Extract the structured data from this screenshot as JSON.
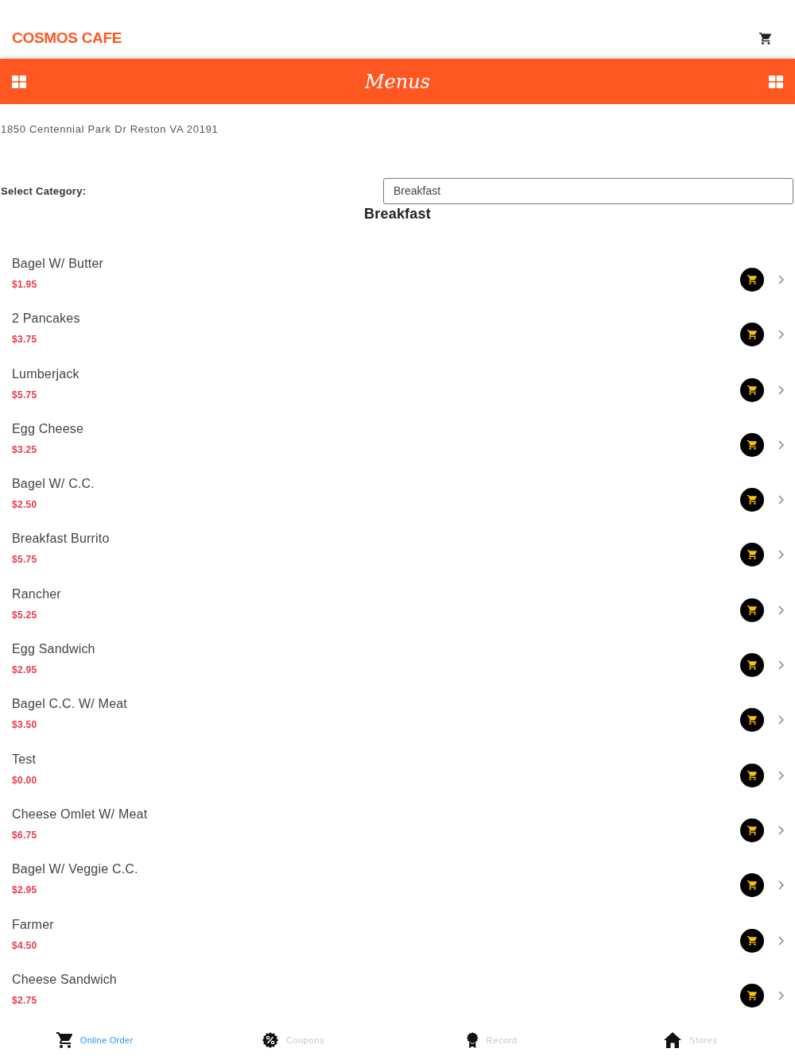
{
  "header": {
    "title": "COSMOS CAFE"
  },
  "menu_bar": {
    "title": "Menus"
  },
  "address": "1850 Centennial Park Dr Reston VA 20191",
  "category": {
    "label": "Select Category:",
    "value": "Breakfast"
  },
  "section_title": "Breakfast",
  "items": [
    {
      "name": "Bagel W/ Butter",
      "price": "$1.95"
    },
    {
      "name": "2 Pancakes",
      "price": "$3.75"
    },
    {
      "name": "Lumberjack",
      "price": "$5.75"
    },
    {
      "name": "Egg Cheese",
      "price": "$3.25"
    },
    {
      "name": "Bagel W/ C.C.",
      "price": "$2.50"
    },
    {
      "name": "Breakfast Burrito",
      "price": "$5.75"
    },
    {
      "name": "Rancher",
      "price": "$5.25"
    },
    {
      "name": "Egg Sandwich",
      "price": "$2.95"
    },
    {
      "name": "Bagel C.C. W/ Meat",
      "price": "$3.50"
    },
    {
      "name": "Test",
      "price": "$0.00"
    },
    {
      "name": "Cheese Omlet W/ Meat",
      "price": "$6.75"
    },
    {
      "name": "Bagel W/ Veggie C.C.",
      "price": "$2.95"
    },
    {
      "name": "Farmer",
      "price": "$4.50"
    },
    {
      "name": "Cheese Sandwich",
      "price": "$2.75"
    }
  ],
  "bottom_nav": [
    {
      "label": "Online Order",
      "kind": "order",
      "selected": true
    },
    {
      "label": "Coupons",
      "kind": "coupons",
      "selected": false
    },
    {
      "label": "Record",
      "kind": "record",
      "selected": false
    },
    {
      "label": "Stores",
      "kind": "stores",
      "selected": false
    }
  ]
}
